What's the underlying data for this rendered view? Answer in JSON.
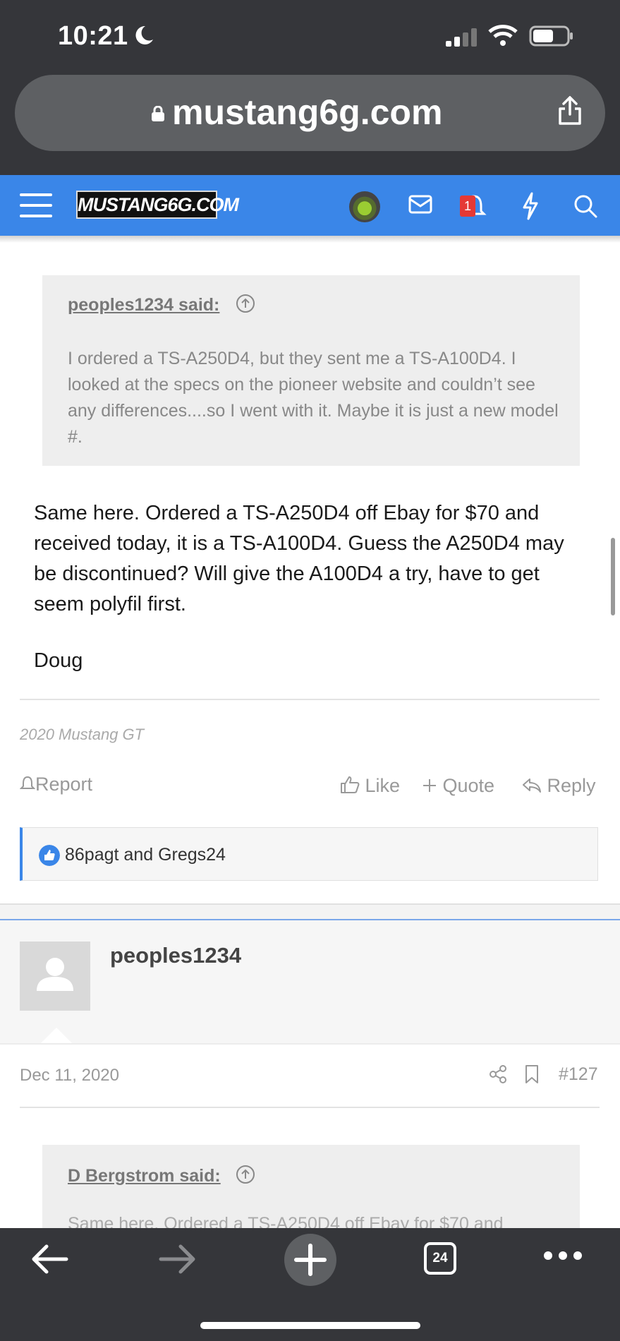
{
  "status_bar": {
    "time": "10:21"
  },
  "browser": {
    "url": "mustang6g.com",
    "tab_count": "24"
  },
  "site": {
    "logo_text": "MUSTANG6G.COM",
    "alert_count": "1",
    "accent_color": "#3a86e8"
  },
  "post1": {
    "quote": {
      "author": "peoples1234 said:",
      "text": "I ordered a TS-A250D4, but they sent me a TS-A100D4. I looked at the specs on the pioneer website and couldn’t see any differences....so I went with it. Maybe it is just a new model #."
    },
    "body": "Same here. Ordered a TS-A250D4 off Ebay for $70 and received today, it is a TS-A100D4. Guess the A250D4 may be discontinued? Will give the A100D4 a try, have to get seem polyfil first.",
    "sign_off": "Doug",
    "signature": "2020 Mustang GT",
    "actions": {
      "report": "Report",
      "like": "Like",
      "quote": "Quote",
      "reply": "Reply"
    },
    "reactions": "86pagt and Gregs24"
  },
  "post2": {
    "username": "peoples1234",
    "date": "Dec 11, 2020",
    "number": "#127",
    "quote": {
      "author": "D Bergstrom said:",
      "text": "Same here. Ordered a TS-A250D4 off Ebay for $70 and"
    }
  }
}
